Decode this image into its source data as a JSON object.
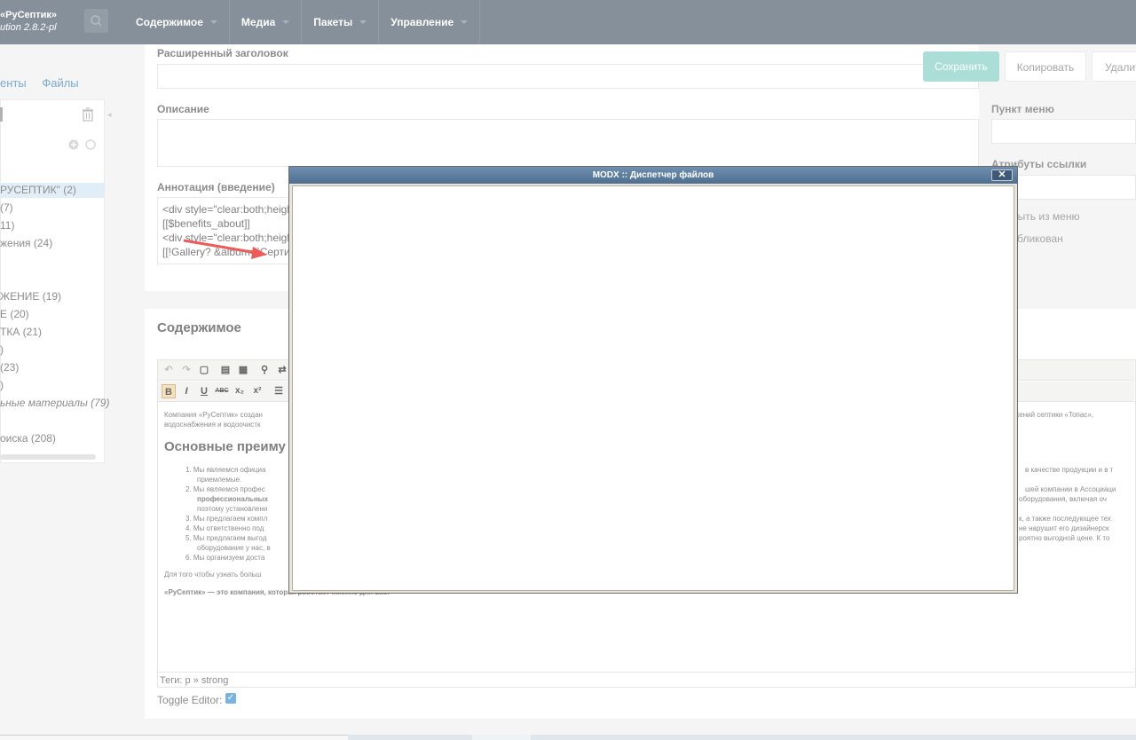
{
  "topbar": {
    "brand_name": "«РуСептик»",
    "brand_version": "ution 2.8.2-pl",
    "menu": [
      "Содержимое",
      "Медиа",
      "Пакеты",
      "Управление"
    ]
  },
  "left": {
    "tabs": [
      "енты",
      "Файлы"
    ],
    "tree": [
      {
        "label": "РУСЕПТИК\" (2)",
        "active": true
      },
      {
        "label": "(7)"
      },
      {
        "label": "11)"
      },
      {
        "label": "жения (24)"
      },
      {
        "label": "ЖЕНИЕ (19)"
      },
      {
        "label": "Е (20)"
      },
      {
        "label": "ТКА (21)"
      },
      {
        "label": ")"
      },
      {
        "label": "(23)"
      },
      {
        "label": ")"
      },
      {
        "label": "ьные материалы (79)",
        "italic": true
      },
      {
        "label": "оиска (208)"
      }
    ]
  },
  "form": {
    "extended_title_label": "Расширенный заголовок",
    "description_label": "Описание",
    "annotation_label": "Аннотация (введение)",
    "annotation_lines": [
      "<div style=\"clear:both;heigh",
      "[[$benefits_about]]",
      "<div style=\"clear:both;heigh",
      "[[!Gallery? &album=`Серти"
    ]
  },
  "content": {
    "section_title": "Содержимое",
    "editor_intro_1": "Компания «РуСептик» создан",
    "editor_intro_2": "водоснабжения и водоочистк",
    "editor_heading": "Основные преиму",
    "list": [
      "1. Мы являемся официа",
      "приемлемые.",
      "2. Мы являемся профес",
      "профессиональных",
      "поэтому установлени",
      "3. Мы предлагаем компл",
      "4. Мы ответственно под",
      "5. Мы предлагаем выгод",
      "оборудование у нас, в",
      "6. Мы организуем доста"
    ],
    "footer_para": "Для того чтобы узнать больш",
    "footer_strong": "«РуСептик» — это компания, которая работает именно для вас!",
    "right_text": [
      "оружений септики «Топас»,",
      "в качестве продукции и в т",
      "шей компании в Ассоциаци",
      "оборудования, включая оч",
      "к, а также последующее тех",
      "не нарушит его дизайнерск",
      "роятно выгодной цене. К то"
    ],
    "tags_label": "Теги: p » strong",
    "toggle_label": "Toggle Editor:"
  },
  "right": {
    "save": "Сохранить",
    "copy": "Копировать",
    "delete": "Удалит",
    "menu_item_label": "Пункт меню",
    "link_attrs_label": "Атрибуты ссылки",
    "hide_menu": "рыть из меню",
    "published": "убликован"
  },
  "modal": {
    "title": "MODX :: Диспетчер файлов",
    "close": "✕"
  }
}
